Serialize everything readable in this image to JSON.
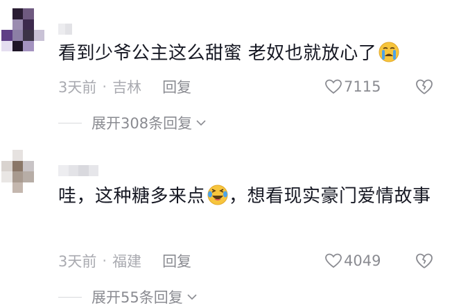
{
  "comments": [
    {
      "text": "看到少爷公主这么甜蜜 老奴也就放心了",
      "emoji": "crying-face",
      "time": "3天前",
      "separator": "·",
      "location": "吉林",
      "reply_label": "回复",
      "likes": "7115",
      "expand_label": "展开308条回复"
    },
    {
      "text_before_emoji": "哇，这种糖多来点",
      "emoji": "laughing-crying-face",
      "text_after_emoji": "，想看现实豪门爱情故事",
      "time": "3天前",
      "separator": "·",
      "location": "福建",
      "reply_label": "回复",
      "likes": "4049",
      "expand_label": "展开55条回复"
    }
  ],
  "colors": {
    "text": "#161823",
    "meta": "#8a8b91",
    "emoji_yellow": "#f7c53d",
    "tear_blue": "#4da3e8"
  }
}
